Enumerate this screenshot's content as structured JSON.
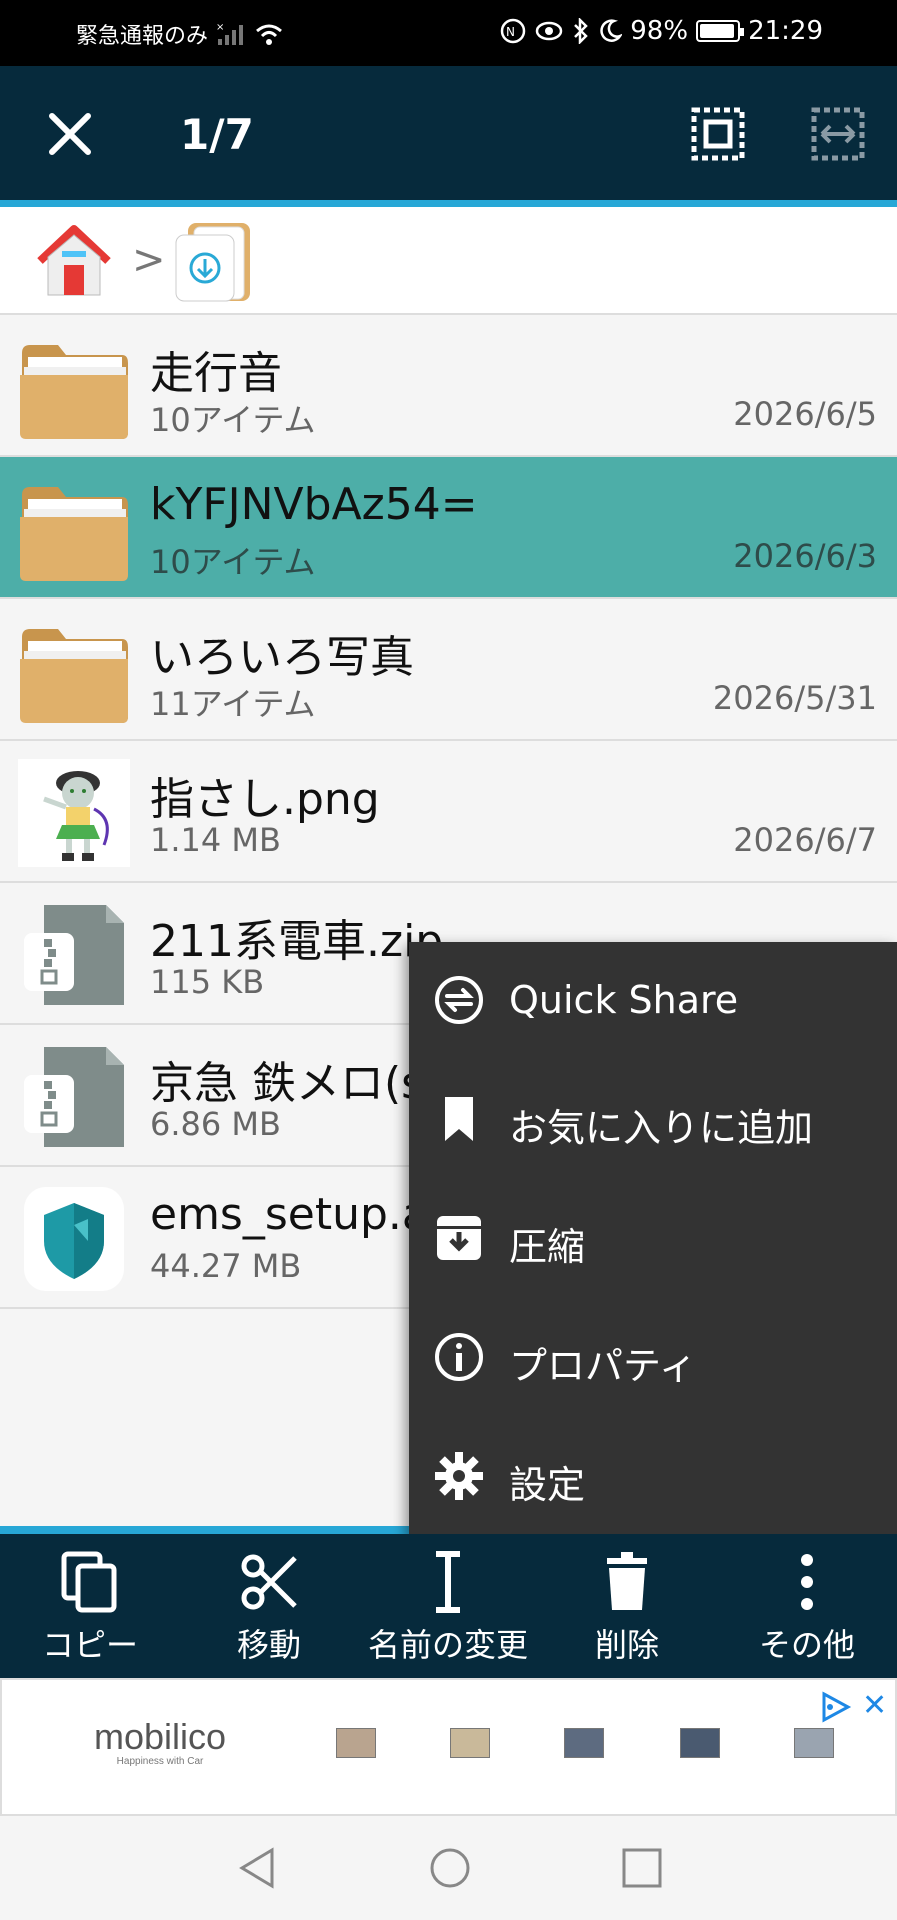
{
  "status_bar": {
    "carrier_text": "緊急通報のみ",
    "battery": "98%",
    "time": "21:29"
  },
  "app_bar": {
    "selection_count": "1/7",
    "icons": [
      "close-icon",
      "select-all-icon",
      "select-range-icon"
    ]
  },
  "breadcrumb": {
    "separator": ">",
    "icons": [
      "home-icon",
      "download-folder-icon"
    ]
  },
  "files": [
    {
      "name": "走行音",
      "meta": "10アイテム",
      "date": "2026/6/5",
      "type": "folder",
      "selected": false
    },
    {
      "name": "kYFJNVbAz54=",
      "meta": "10アイテム",
      "date": "2026/6/3",
      "type": "folder",
      "selected": true
    },
    {
      "name": "いろいろ写真",
      "meta": "11アイテム",
      "date": "2026/5/31",
      "type": "folder",
      "selected": false
    },
    {
      "name": "指さし.png",
      "meta": "1.14 MB",
      "date": "2026/6/7",
      "type": "image",
      "selected": false
    },
    {
      "name": "211系電車.zip",
      "meta": "115 KB",
      "date": "",
      "type": "zip",
      "selected": false
    },
    {
      "name": "京急 鉄メロ(s",
      "meta": "6.86 MB",
      "date": "",
      "type": "zip",
      "selected": false
    },
    {
      "name": "ems_setup.ap",
      "meta": "44.27 MB",
      "date": "",
      "type": "apk",
      "selected": false
    }
  ],
  "popup_menu": [
    {
      "label": "Quick Share",
      "icon": "quick-share-icon"
    },
    {
      "label": "お気に入りに追加",
      "icon": "bookmark-icon"
    },
    {
      "label": "圧縮",
      "icon": "archive-icon"
    },
    {
      "label": "プロパティ",
      "icon": "info-icon"
    },
    {
      "label": "設定",
      "icon": "gear-icon"
    }
  ],
  "toolbar": [
    {
      "label": "コピー",
      "icon": "copy-icon"
    },
    {
      "label": "移動",
      "icon": "scissors-icon"
    },
    {
      "label": "名前の変更",
      "icon": "rename-cursor-icon"
    },
    {
      "label": "削除",
      "icon": "trash-icon"
    },
    {
      "label": "その他",
      "icon": "more-vert-icon"
    }
  ],
  "ad": {
    "logo_text": "mobilico",
    "logo_subtext": "Happiness with Car",
    "close": "✕"
  },
  "colors": {
    "app_bar": "#062a3c",
    "accent": "#27a7d6",
    "selected_row": "#4daea8",
    "menu_bg": "#333333",
    "folder": "#e0b06a"
  }
}
